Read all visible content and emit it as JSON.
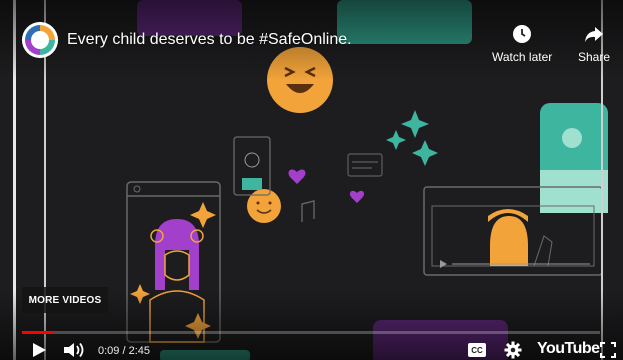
{
  "header": {
    "title": "Every child deserves to be #SafeOnline.",
    "channel_logo_icon": "channel-logo"
  },
  "actions": {
    "watch_later_label": "Watch later",
    "share_label": "Share"
  },
  "overlay": {
    "more_videos_label": "MORE VIDEOS"
  },
  "controls": {
    "time_display": "0:09 / 2:45",
    "progress_fraction": 0.055,
    "brand_label": "YouTube"
  },
  "colors": {
    "accent_red": "#ff0000",
    "teal": "#3eb59f",
    "orange": "#f2a33a",
    "purple": "#a23fcb",
    "background": "#1d1d1f"
  },
  "icons": [
    "clock-icon",
    "share-icon",
    "play-icon",
    "volume-icon",
    "captions-icon",
    "settings-icon",
    "fullscreen-icon"
  ]
}
